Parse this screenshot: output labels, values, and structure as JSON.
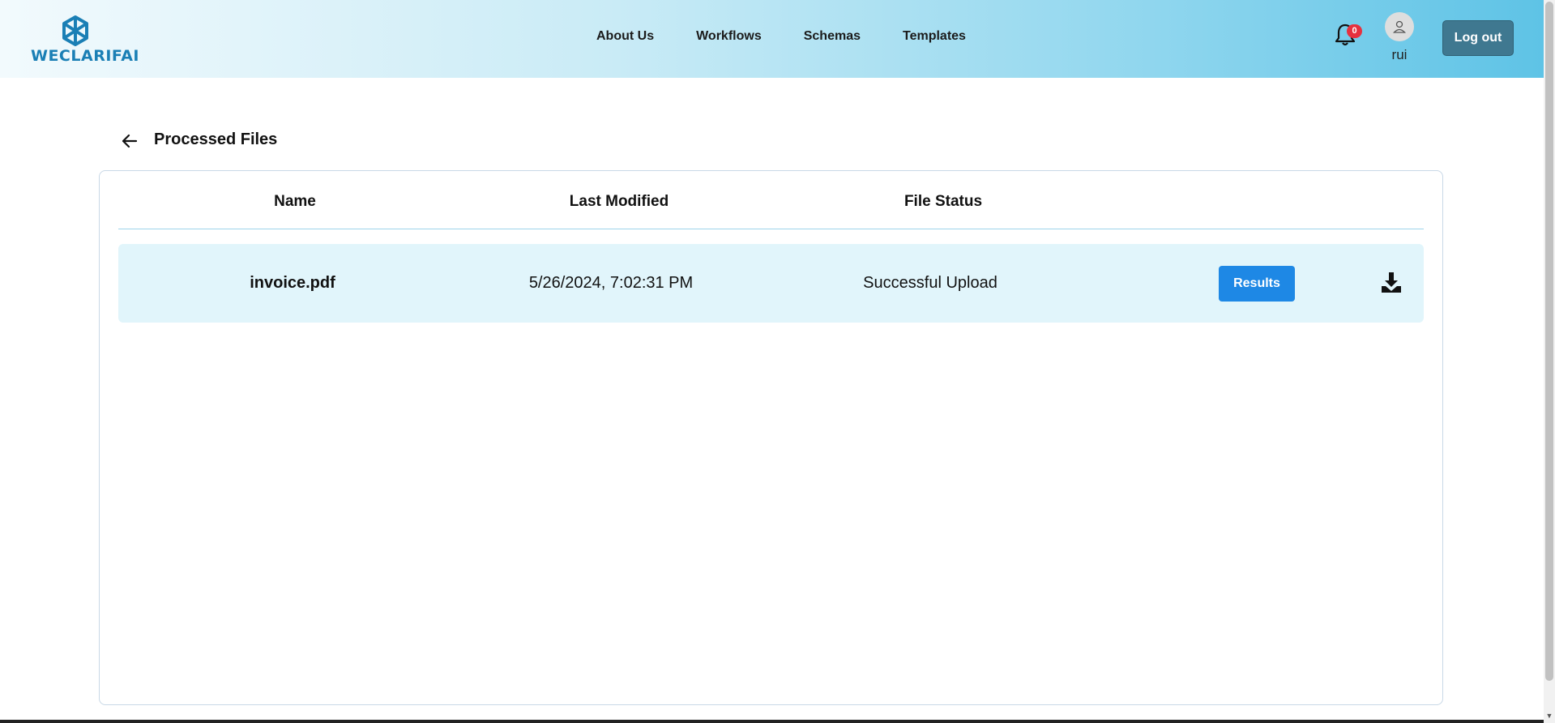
{
  "header": {
    "logo_text": "WECLARIFAI",
    "nav": [
      "About Us",
      "Workflows",
      "Schemas",
      "Templates"
    ],
    "notification_count": "0",
    "username": "rui",
    "logout_label": "Log out"
  },
  "page": {
    "title": "Processed Files"
  },
  "table": {
    "columns": [
      "Name",
      "Last Modified",
      "File Status"
    ],
    "rows": [
      {
        "name": "invoice.pdf",
        "last_modified": "5/26/2024, 7:02:31 PM",
        "status": "Successful Upload",
        "action_label": "Results"
      }
    ]
  },
  "colors": {
    "accent": "#1e88e5",
    "logout": "#3f7890",
    "row_background": "#e1f5fb",
    "badge": "#e6313f"
  },
  "icons": [
    "logo-icon",
    "bell-icon",
    "user-icon",
    "arrow-left-icon",
    "download-icon"
  ]
}
